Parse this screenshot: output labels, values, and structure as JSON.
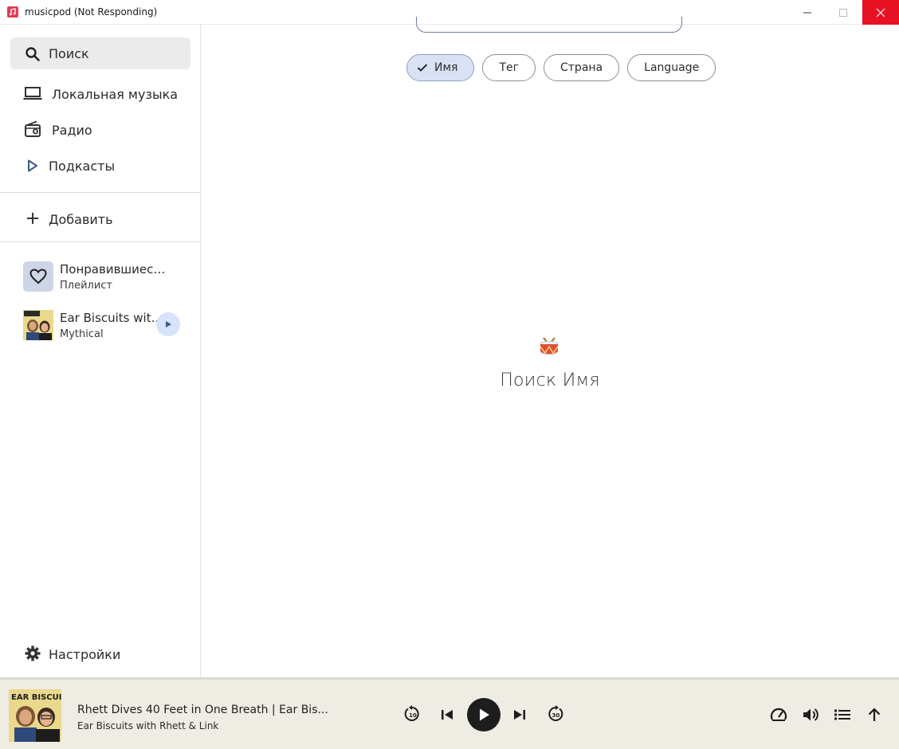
{
  "window": {
    "title": "musicpod (Not Responding)"
  },
  "sidebar": {
    "nav": [
      {
        "label": "Поиск",
        "icon": "search-icon"
      },
      {
        "label": "Локальная музыка",
        "icon": "laptop-icon"
      },
      {
        "label": "Радио",
        "icon": "radio-icon"
      },
      {
        "label": "Подкасты",
        "icon": "play-outline-icon"
      }
    ],
    "add_label": "Добавить",
    "library": [
      {
        "title": "Понравившиеся...",
        "subtitle": "Плейлист",
        "icon": "heart-icon"
      },
      {
        "title": "Ear Biscuits wit...",
        "subtitle": "Mythical",
        "icon": "podcast-cover"
      }
    ],
    "settings_label": "Настройки"
  },
  "main": {
    "chips": [
      {
        "label": "Имя",
        "selected": true
      },
      {
        "label": "Тег",
        "selected": false
      },
      {
        "label": "Страна",
        "selected": false
      },
      {
        "label": "Language",
        "selected": false
      }
    ],
    "empty_state": {
      "icon": "drum-icon",
      "text": "Поиск Имя"
    }
  },
  "player": {
    "cover_text": "EAR BISCUITS",
    "track_title": "Rhett Dives 40 Feet in One Breath | Ear Bis...",
    "track_artist": "Ear Biscuits with Rhett & Link",
    "rewind_label": "10",
    "forward_label": "30",
    "colors": {
      "background": "#efece4",
      "play_button": "#1d1d1d",
      "accent": "#d6e3fa",
      "close": "#e81123"
    }
  }
}
